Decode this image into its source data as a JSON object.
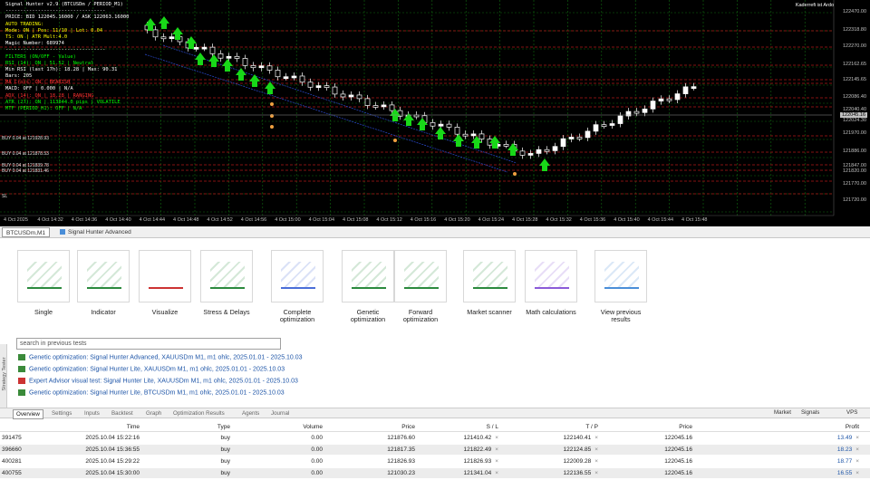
{
  "chart": {
    "info_lines": [
      {
        "text": "Signal Hunter v2.9 (BTCUSDm / PERIOD_M1)",
        "color": "#ffffff"
      },
      {
        "text": "----------------------------------",
        "color": "#ffffff"
      },
      {
        "text": "PRICE: BID 122045.16000 / ASK 122063.16000",
        "color": "#ffffff"
      },
      {
        "text": "AUTO TRADING:",
        "color": "#ffff00"
      },
      {
        "text": "Mode: ON | Pos: 11/10 | Lot: 0.04",
        "color": "#ffff00"
      },
      {
        "text": "TS: ON | ATR Mult:4.0",
        "color": "#ffff00"
      },
      {
        "text": "Magic Number: 689974",
        "color": "#ffffff"
      },
      {
        "text": "----------------------------------",
        "color": "#ffffff"
      },
      {
        "text": "FILTERS (ON/OFF - Value)",
        "color": "#00ff00"
      },
      {
        "text": "RSI (14): ON | 51.52 | Neutral",
        "color": "#00ff00"
      },
      {
        "text": "Min RSI (last 17h): 18.28 | Max: 90.31",
        "color": "#ffffff"
      },
      {
        "text": "Bars: 205",
        "color": "#ffffff"
      },
      {
        "text": "MA Cross: ON | BEARISH",
        "color": "#ff3030"
      },
      {
        "text": "MACD: OFF | 0.000 | N/A",
        "color": "#ffffff"
      },
      {
        "text": "ADX (14): ON | 18.28 | RANGING",
        "color": "#ff3030"
      },
      {
        "text": "ATR (27): ON | 113844.0 pips | VOLATILE",
        "color": "#00ff00"
      },
      {
        "text": "MTF (PERIOD_H1): OFF | N/A",
        "color": "#00ff00"
      }
    ],
    "account_label": "Kaderrefi ist Ardo",
    "price_labels": [
      "122470.00",
      "122318.80",
      "122270.00",
      "122162.65",
      "122145.65",
      "122086.40",
      "122040.40",
      "122024.30",
      "121970.00",
      "121886.00",
      "121847.00",
      "121820.00",
      "121770.00",
      "121720.00"
    ],
    "current_price": "122045.16",
    "level_labels": [
      "BUY 0.04 at 121928.93",
      "BUY 0.04 at 121878.53",
      "BUY 0.04 at 121839.78",
      "BUY 0.04 at 121831.46",
      "SL"
    ],
    "time_labels": [
      "4 Oct 2025",
      "4 Oct 14:32",
      "4 Oct 14:36",
      "4 Oct 14:40",
      "4 Oct 14:44",
      "4 Oct 14:48",
      "4 Oct 14:52",
      "4 Oct 14:56",
      "4 Oct 15:00",
      "4 Oct 15:04",
      "4 Oct 15:08",
      "4 Oct 15:12",
      "4 Oct 15:16",
      "4 Oct 15:20",
      "4 Oct 15:24",
      "4 Oct 15:28",
      "4 Oct 15:32",
      "4 Oct 15:36",
      "4 Oct 15:40",
      "4 Oct 15:44",
      "4 Oct 15:48"
    ],
    "colors": {
      "bull_candle": "#ffffff",
      "bear_candle": "#000000",
      "grid": "#0f6a0f",
      "level_line": "#b01818",
      "arrow": "#18d818"
    }
  },
  "chart_tabs": {
    "active": "BTCUSDm,M1",
    "tester": "Signal Hunter Advanced"
  },
  "tools": [
    {
      "label": "Single",
      "icon": "single-test-icon"
    },
    {
      "label": "Indicator",
      "icon": "indicator-icon"
    },
    {
      "label": "Visualize",
      "icon": "visualize-icon"
    },
    {
      "label": "Stress & Delays",
      "icon": "stress-delays-icon"
    },
    {
      "label": "Complete optimization",
      "icon": "complete-optimization-icon"
    },
    {
      "label": "Genetic optimization",
      "icon": "genetic-optimization-icon"
    },
    {
      "label": "Forward optimization",
      "icon": "forward-optimization-icon"
    },
    {
      "label": "Market scanner",
      "icon": "market-scanner-icon"
    },
    {
      "label": "Math calculations",
      "icon": "math-calculations-icon"
    },
    {
      "label": "View previous results",
      "icon": "view-previous-results-icon"
    }
  ],
  "search": {
    "placeholder": "search in previous tests"
  },
  "history": [
    {
      "text": "Genetic optimization: Signal Hunter Advanced, XAUUSDm M1, m1 ohlc, 2025.01.01 - 2025.10.03",
      "icon": "genetic-optimization-icon"
    },
    {
      "text": "Genetic optimization: Signal Hunter Lite, XAUUSDm M1, m1 ohlc, 2025.01.01 - 2025.10.03",
      "icon": "genetic-optimization-icon"
    },
    {
      "text": "Expert Advisor visual test: Signal Hunter Lite, XAUUSDm M1, m1 ohlc, 2025.01.01 - 2025.10.03",
      "icon": "visual-test-icon"
    },
    {
      "text": "Genetic optimization: Signal Hunter Lite, BTCUSDm M1, m1 ohlc, 2025.01.01 - 2025.10.03",
      "icon": "genetic-optimization-icon"
    }
  ],
  "side_label": "Strategy Tester",
  "bottom_tabs": [
    "Overview",
    "Settings",
    "Inputs",
    "Backtest",
    "Graph",
    "Optimization Results",
    "Agents",
    "Journal"
  ],
  "bottom_active": "Overview",
  "right_tabs": [
    "Market",
    "Signals",
    "VPS"
  ],
  "orders": {
    "columns": [
      "",
      "Time",
      "Type",
      "Volume",
      "Price",
      "S / L",
      "T / P",
      "Price",
      "Profit"
    ],
    "rows": [
      {
        "id": "391475",
        "time": "2025.10.04 15:22:16",
        "type": "buy",
        "volume": "0.00",
        "price": "121876.60",
        "sl": "121410.42",
        "tp": "122140.41",
        "cur": "122045.16",
        "profit": "13.49"
      },
      {
        "id": "396660",
        "time": "2025.10.04 15:36:55",
        "type": "buy",
        "volume": "0.00",
        "price": "121817.35",
        "sl": "121822.49",
        "tp": "122124.85",
        "cur": "122045.16",
        "profit": "18.23"
      },
      {
        "id": "400281",
        "time": "2025.10.04 15:29:22",
        "type": "buy",
        "volume": "0.00",
        "price": "121826.93",
        "sl": "121826.93",
        "tp": "122009.28",
        "cur": "122045.16",
        "profit": "18.77"
      },
      {
        "id": "400755",
        "time": "2025.10.04 15:30:00",
        "type": "buy",
        "volume": "0.00",
        "price": "121030.23",
        "sl": "121341.04",
        "tp": "122136.55",
        "cur": "122045.16",
        "profit": "16.55"
      }
    ]
  }
}
